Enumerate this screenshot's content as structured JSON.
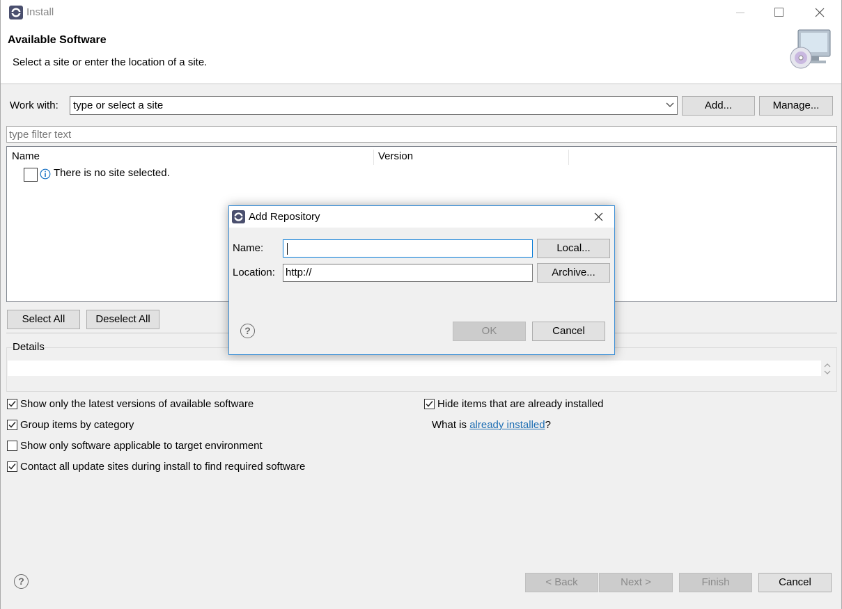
{
  "window": {
    "title": "Install",
    "header_title": "Available Software",
    "header_description": "Select a site or enter the location of a site."
  },
  "work_with": {
    "label": "Work with:",
    "combo_text": "type or select a site",
    "add_label": "Add...",
    "manage_label": "Manage..."
  },
  "filter": {
    "placeholder": "type filter text"
  },
  "table": {
    "columns": [
      "Name",
      "Version"
    ],
    "rows": [
      {
        "text": "There is no site selected.",
        "checked": false,
        "icon": "info-icon"
      }
    ]
  },
  "selection": {
    "select_all": "Select All",
    "deselect_all": "Deselect All"
  },
  "details": {
    "label": "Details"
  },
  "options": {
    "show_latest": {
      "label": "Show only the latest versions of available software",
      "checked": true
    },
    "group_by_category": {
      "label": "Group items by category",
      "checked": true
    },
    "show_applicable": {
      "label": "Show only software applicable to target environment",
      "checked": false
    },
    "contact_all_sites": {
      "label": "Contact all update sites during install to find required software",
      "checked": true
    },
    "hide_installed": {
      "label": "Hide items that are already installed",
      "checked": true
    },
    "what_is_prefix": "What is ",
    "what_is_link": "already installed",
    "what_is_suffix": "?"
  },
  "footer": {
    "back": "< Back",
    "next": "Next >",
    "finish": "Finish",
    "cancel": "Cancel"
  },
  "dialog": {
    "title": "Add Repository",
    "name_label": "Name:",
    "name_value": "",
    "location_label": "Location:",
    "location_value": "http://",
    "local_label": "Local...",
    "archive_label": "Archive...",
    "ok_label": "OK",
    "cancel_label": "Cancel"
  },
  "colors": {
    "accent": "#0078d7",
    "link": "#1f6fb4",
    "dialog_border": "#3c8fd6"
  }
}
